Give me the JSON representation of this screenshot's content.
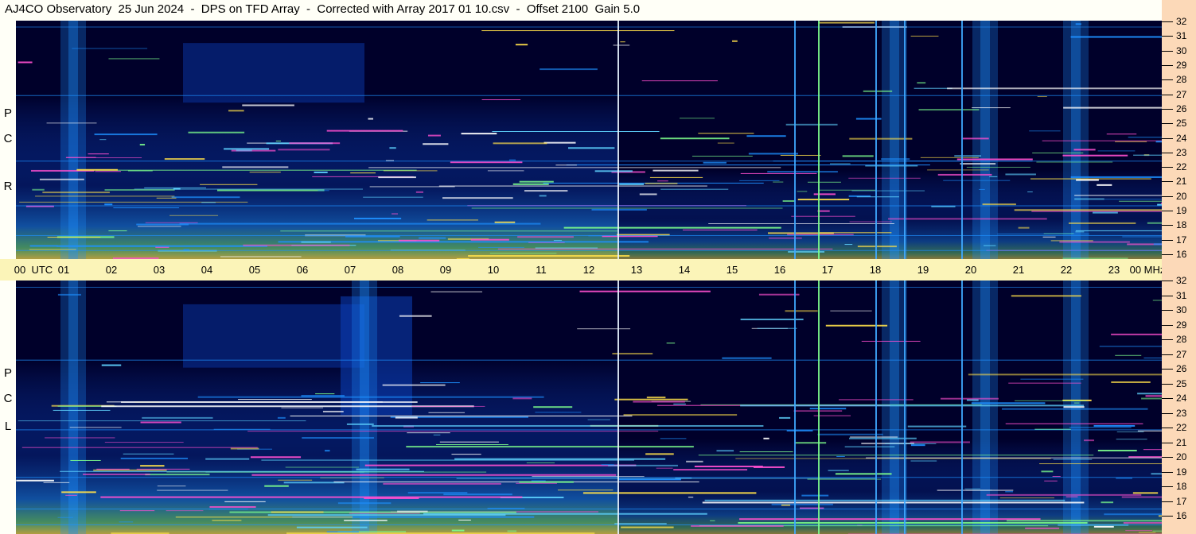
{
  "title": "AJ4CO Observatory  25 Jun 2024  -  DPS on TFD Array  -  Corrected with Array 2017 01 10.csv  -  Offset 2100  Gain 5.0",
  "colors": {
    "background": "#00002a",
    "header": "#fffff7",
    "utc_strip": "#fbf4b8",
    "freq_axis": "#fcd9b8",
    "noise_low": "#0b3fb8",
    "noise_mid": "#1e90ff",
    "noise_high": "#7cfc8c",
    "noise_peak": "#ffe04a",
    "rfi_hot": "#ff4fd0"
  },
  "chart_data": [
    {
      "type": "heatmap",
      "panel": "rcp",
      "polarization_label": [
        "R",
        "C",
        "P"
      ],
      "x_axis": "UTC",
      "y_axis": "MHz",
      "xlim": [
        0,
        24
      ],
      "ylim": [
        16,
        32
      ],
      "vertical_interference_lines_utc": [
        12.6,
        16.3,
        16.8,
        18.0,
        18.6,
        19.8
      ],
      "broadband_columns_utc": [
        1.2,
        18.4,
        20.3,
        22.2
      ]
    },
    {
      "type": "heatmap",
      "panel": "lcp",
      "polarization_label": [
        "L",
        "C",
        "P"
      ],
      "x_axis": "UTC",
      "y_axis": "MHz",
      "xlim": [
        0,
        24
      ],
      "ylim": [
        16,
        32
      ],
      "vertical_interference_lines_utc": [
        12.6,
        16.3,
        16.8,
        18.0,
        18.6,
        19.8
      ],
      "broadband_columns_utc": [
        1.2,
        7.3,
        18.4,
        20.3,
        22.2
      ]
    }
  ],
  "utc_axis": {
    "labels": [
      "00  UTC",
      "01",
      "02",
      "03",
      "04",
      "05",
      "06",
      "07",
      "08",
      "09",
      "10",
      "11",
      "12",
      "13",
      "14",
      "15",
      "16",
      "17",
      "18",
      "19",
      "20",
      "21",
      "22",
      "23",
      "00 MHz"
    ]
  },
  "freq_axis": {
    "labels": [
      "32",
      "31",
      "30",
      "29",
      "28",
      "27",
      "26",
      "25",
      "24",
      "23",
      "22",
      "21",
      "20",
      "19",
      "18",
      "17",
      "16"
    ]
  }
}
